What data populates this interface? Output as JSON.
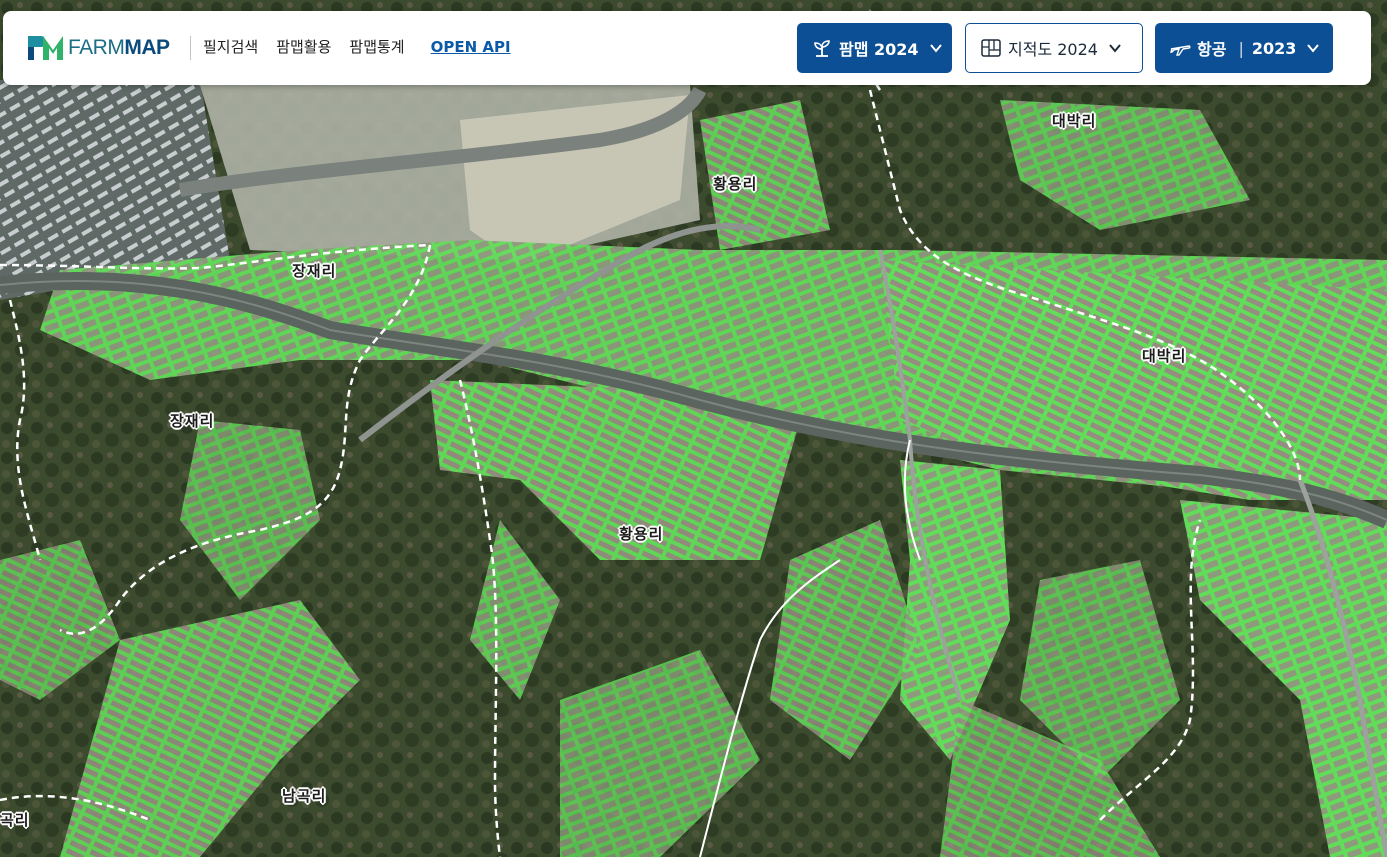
{
  "header": {
    "logo_text_farm": "FARM",
    "logo_text_map": "MAP",
    "nav": [
      "필지검색",
      "팜맵활용",
      "팜맵통계"
    ],
    "open_api": "OPEN API",
    "farmmap_button": {
      "label": "팜맵 2024",
      "icon": "sprout-icon"
    },
    "cadastral_button": {
      "label": "지적도 2024",
      "icon": "parcel-map-icon"
    },
    "aerial_button": {
      "label": "항공",
      "year": "2023",
      "icon": "airplane-icon"
    }
  },
  "map": {
    "labels": [
      {
        "text": "대박리"
      },
      {
        "text": "황용리"
      },
      {
        "text": "장재리"
      },
      {
        "text": "대박리"
      },
      {
        "text": "장재리"
      },
      {
        "text": "황용리"
      },
      {
        "text": "남곡리"
      },
      {
        "text": "곡리"
      }
    ]
  },
  "colors": {
    "brand": "#0d4f94",
    "parcel_fill": "#67e35e",
    "parcel_stroke": "#6ff06a",
    "boundary": "#ffffff"
  }
}
